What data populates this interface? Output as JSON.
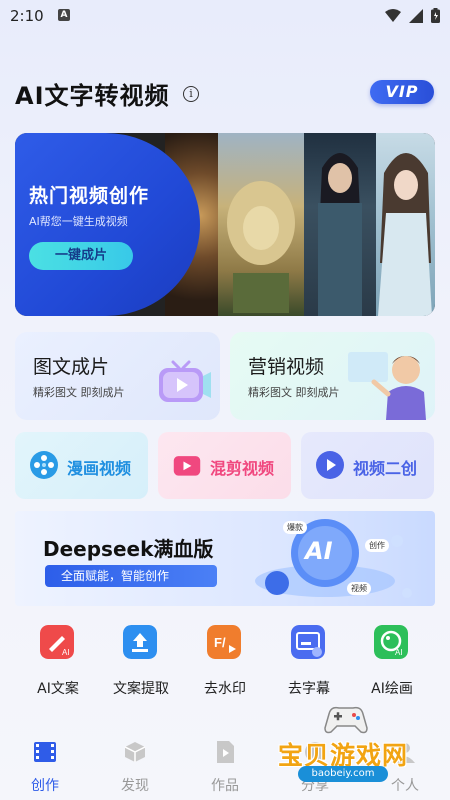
{
  "status": {
    "time": "2:10",
    "badge": "A"
  },
  "header": {
    "title": "AI文字转视频",
    "info_icon": "i",
    "vip_label": "VIP"
  },
  "banner": {
    "title": "热门视频创作",
    "subtitle": "AI帮您一键生成视频",
    "button_label": "一键成片"
  },
  "cards": [
    {
      "title": "图文成片",
      "subtitle": "精彩图文 即刻成片"
    },
    {
      "title": "营销视频",
      "subtitle": "精彩图文 即刻成片"
    }
  ],
  "small_cards": [
    {
      "label": "漫画视频",
      "color": "#1f8fe0"
    },
    {
      "label": "混剪视频",
      "color": "#f0487f"
    },
    {
      "label": "视频二创",
      "color": "#4a63e6"
    }
  ],
  "deepseek": {
    "title": "Deepseek满血版",
    "tag": "全面赋能，智能创作",
    "ai_label": "AI",
    "bubbles": [
      "爆款",
      "创作",
      "视频"
    ]
  },
  "tools": [
    {
      "label": "AI文案",
      "color": "#ef4a4a"
    },
    {
      "label": "文案提取",
      "color": "#2d8ff0"
    },
    {
      "label": "去水印",
      "color": "#f07d2d"
    },
    {
      "label": "去字幕",
      "color": "#4a6cf0"
    },
    {
      "label": "AI绘画",
      "color": "#2dbf5a"
    }
  ],
  "nav": [
    {
      "label": "创作",
      "active": true
    },
    {
      "label": "发现",
      "active": false
    },
    {
      "label": "作品",
      "active": false
    },
    {
      "label": "分享",
      "active": false
    },
    {
      "label": "个人",
      "active": false
    }
  ],
  "watermark": {
    "text": "宝贝游戏网",
    "url": "baobeiy.com"
  },
  "colors": {
    "accent": "#2f5ce8",
    "vip": "#3a62ee"
  }
}
